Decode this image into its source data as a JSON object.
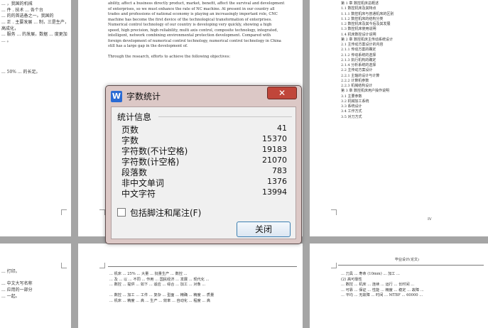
{
  "dialog": {
    "title": "字数统计",
    "app_icon": "W",
    "close_glyph": "✕",
    "group_label": "统计信息",
    "stats": [
      {
        "label": "页数",
        "value": "41"
      },
      {
        "label": "字数",
        "value": "15370"
      },
      {
        "label": "字符数(不计空格)",
        "value": "19183"
      },
      {
        "label": "字符数(计空格)",
        "value": "21070"
      },
      {
        "label": "段落数",
        "value": "783"
      },
      {
        "label": "非中文单词",
        "value": "1376"
      },
      {
        "label": "中文字符",
        "value": "13994"
      }
    ],
    "checkbox_label": "包括脚注和尾注(F)",
    "checkbox_checked": false,
    "close_button": "关闭"
  },
  "pages": {
    "top_left": "... ，我国的机械\n... 件 . 技术 ... 各个台\n... 的的首选备之一。我国的\n... 正 . 主要发展 ... 制，三是生产，高成化，\n... 服务 ... 的发展，数据 ... 度更加\n... 。\n\n\n\n\n... 50% ... 的长足。",
    "top_middle": "ability, affect a business directly product, market, benefit, affect the survival and development\nof enterprises, so we must enhance the rate of NC machine. At present in our country all\ntrades and professions of national economy is playing an increasingly important role, CNC\nmachine has become the first device of the technological transformation of enterprises.\nNumerical control technology of our country is developing very quickly, showing a high\nspeed, high precision, high reliability, multi axis control, composite technology, integrated,\nintelligent, network combining environmental protection development. Compared with\nforeign development of numerical control technology, numerical control technology in China\nstill has a large gap in the development of.\n\nThrough the research, efforts to achieve the following objectives:",
    "top_right": "第 1 章  数控机床总概述\n1.1 数控机床及其特点\n1.1.1 数控机床与普通机床的区别\n1.1.2 数控机床的结构分类\n1.2 数控机床及其今后及其发展\n1.3 数控机床使用说明\n1.4 机床数控设计说明\n第 2 章  数控机床主传动系统设计\n2.1 主传动方案设计的内容\n2.1.1 传动方案的确定\n2.1.2 传动系统的选择\n2.1.3 执行机构的确定\n2.1.4 分析系统的选择\n2.2 主传动方案设计\n2.2.1 主轴的设计与计算\n2.2.2 计算机参数\n2.2.3 机械结构设计\n第 3 章  数控机床用户操作说明\n3.1 主要参数\n3.2 机械加工系统\n3.3 系统设计\n3.4 工作方式\n3.5 对刀方式",
    "bottom_left": "... 打印。\n\n... 中文大写名称\n... 应用的一部分\n... 一起。",
    "bottom_middle": "... 机床 ... 25% ... 大量 ... 批量生产 ... 数控 ... \n... 及 ... 以 ... 不同 ... 作用 ... 国民经济 ... 发展 ... 现代化 ...\n... 数控 ... 提供 ... 如下 ... 适应 ... 综合 ... 加工 ... 对象 ...\n\n... 数控 ... 加工 ... 工件 ... 复杂 ... 型面 ... 精确 ... 精度 ... 质量\n... 机床 ... 精度 ... 高 ... 生产 ... 效率 ... 自动化 ... 程度 ... 高",
    "bottom_right_header": "毕业设计(论文)",
    "bottom_right": "... 刀具 ... 寿命 (10mm) ... 加工 ... \n(2) 高可靠性\n... 数控 ... 机床 ... 连续 ... 运行 ... 长时间 ... \n... 可靠 ... 保证 ... 性能 ... 精度 ... 稳定 ... 故障 ... \n... 平均 ... 无故障 ... 时间 ... MTBF ... 60000 ...",
    "page_number": "IV"
  }
}
